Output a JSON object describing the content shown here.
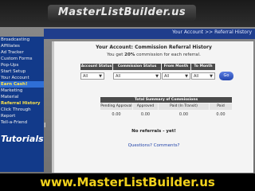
{
  "header": {
    "logo_text": "MasterListBuilder.us"
  },
  "breadcrumb": {
    "parent": "Your Account",
    "separator": ">>",
    "current": "Referral History"
  },
  "sidebar": {
    "items": [
      {
        "label": "Broadcasting"
      },
      {
        "label": "Affiliates"
      },
      {
        "label": "Ad Tracker"
      },
      {
        "label": "Custom Forms"
      },
      {
        "label": "Pop-Ups"
      },
      {
        "label": "Start Setup"
      },
      {
        "label": "Your Account"
      },
      {
        "label": "Earn Cash!"
      },
      {
        "label": "Marketing"
      },
      {
        "label": "Material"
      },
      {
        "label": "Referral History"
      },
      {
        "label": "Click Through"
      },
      {
        "label": "Report"
      },
      {
        "label": "Tell-a-Friend"
      }
    ],
    "tutorials_label": "Tutorials"
  },
  "main": {
    "title": "Your Account: Commission Referral History",
    "commission_prefix": "You get",
    "commission_rate": "20%",
    "commission_suffix": "commission for each referral.",
    "filters": {
      "headers": [
        "Account Status",
        "Commission Status",
        "From Month",
        "To Month"
      ],
      "values": [
        "All",
        "All",
        "All",
        "All"
      ],
      "go_label": "Go"
    },
    "summary": {
      "title": "Total Summary of Commissions",
      "headers": [
        "Pending Approval",
        "Approved",
        "Paid (In Transit)",
        "Paid"
      ],
      "values": [
        "0.00",
        "0.00",
        "0.00",
        "0.00"
      ]
    },
    "no_referrals_text": "No referrals - yet!",
    "questions_link": "Questions? Comments?"
  },
  "footer": {
    "url_text": "www.MasterListBuilder.us"
  },
  "colors": {
    "sidebar_bg": "#123a8a",
    "topnav_bg": "#1f3d8c",
    "footer_text": "#f2d21c",
    "table_header_bg": "#4b4b4b"
  }
}
